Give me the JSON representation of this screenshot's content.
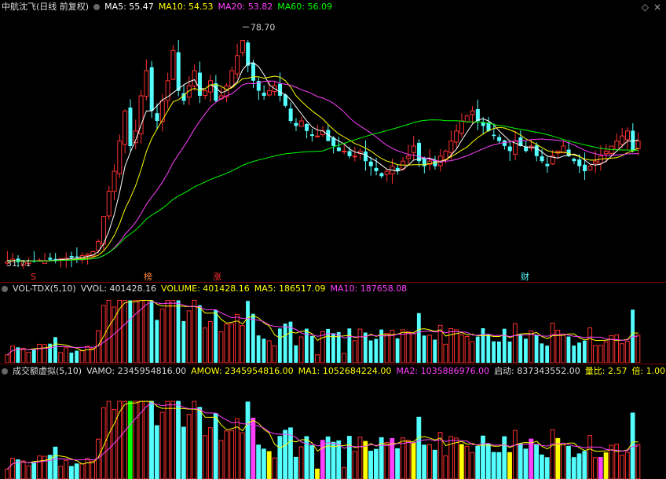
{
  "main": {
    "title": "中航沈飞(日线 前复权)",
    "ma5": "MA5: 55.47",
    "ma10": "MA10: 54.53",
    "ma20": "MA20: 53.82",
    "ma60": "MA60: 56.09",
    "high_label": "78.70",
    "low_label": "31.71",
    "markers": [
      "S",
      "榜",
      "涨",
      "财"
    ],
    "colors": {
      "ma5": "#ffffff",
      "ma10": "#ffff00",
      "ma20": "#ff40ff",
      "ma60": "#00ff00",
      "up": "#ff3030",
      "down": "#54ffff"
    }
  },
  "volume": {
    "title": "VOL-TDX(5,10)",
    "vvol": "VVOL: 401428.16",
    "volume": "VOLUME: 401428.16",
    "ma5": "MA5: 186517.09",
    "ma10": "MA10: 187658.08"
  },
  "amount": {
    "title": "成交额虚拟(5,10)",
    "vamo": "VAMO: 2345954816.00",
    "amow": "AMOW: 2345954816.00",
    "ma1": "MA1: 1052684224.00",
    "ma2": "MA2: 1035886976.00",
    "qidong": "启动: 837343552.00",
    "liangbi": "量比: 2.57",
    "bei": "倍: 1.00"
  },
  "chart_data": [
    {
      "type": "candlestick",
      "title": "中航沈飞(日线 前复权)",
      "series": [
        {
          "name": "MA5",
          "last": 55.47
        },
        {
          "name": "MA10",
          "last": 54.53
        },
        {
          "name": "MA20",
          "last": 53.82
        },
        {
          "name": "MA60",
          "last": 56.09
        }
      ],
      "annotations": {
        "high": 78.7,
        "low": 31.71
      },
      "close": [
        32,
        32.5,
        31.9,
        32,
        32.2,
        32.1,
        32.3,
        32.2,
        32.4,
        32.5,
        32.6,
        32.7,
        32.8,
        33,
        33.2,
        33.5,
        34,
        36,
        41,
        46,
        50,
        56,
        62,
        55,
        58,
        65,
        70,
        62,
        60,
        64,
        68,
        74,
        66,
        64,
        67,
        70,
        65,
        66,
        68,
        64,
        65,
        67,
        70,
        73,
        76,
        71,
        68,
        66,
        65,
        66,
        67,
        65,
        63,
        60,
        59,
        60,
        58,
        57,
        57,
        58,
        56,
        55,
        54,
        54,
        53,
        53,
        54,
        52,
        51,
        50,
        49,
        50,
        51,
        50,
        52,
        53,
        55,
        52,
        51,
        52,
        51,
        53,
        54,
        56,
        58,
        60,
        61,
        62,
        60,
        59,
        58,
        57,
        56,
        55,
        54,
        56,
        55,
        54,
        55,
        53,
        52,
        51,
        53,
        54,
        55,
        53,
        52,
        51,
        50,
        51,
        52,
        53,
        54,
        55,
        56,
        57,
        58,
        54,
        56
      ]
    },
    {
      "type": "bar",
      "title": "VOL-TDX(5,10)",
      "series": [
        {
          "name": "VOLUME",
          "last": 401428.16
        },
        {
          "name": "MA5",
          "last": 186517.09
        },
        {
          "name": "MA10",
          "last": 187658.08
        }
      ]
    },
    {
      "type": "bar",
      "title": "成交额虚拟(5,10)",
      "series": [
        {
          "name": "AMOW",
          "last": 2345954816.0
        },
        {
          "name": "MA1",
          "last": 1052684224.0
        },
        {
          "name": "MA2",
          "last": 1035886976.0
        }
      ]
    }
  ]
}
